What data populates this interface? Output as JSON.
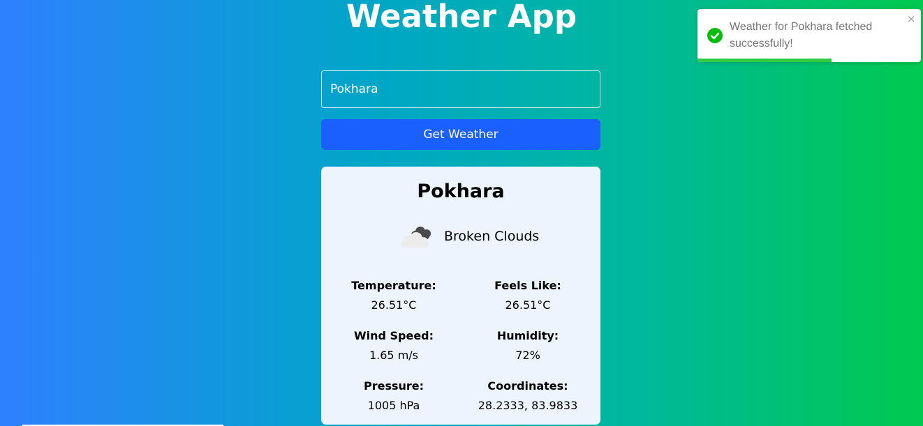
{
  "app": {
    "title": "Weather App"
  },
  "search": {
    "value": "Pokhara",
    "button_label": "Get Weather"
  },
  "weather": {
    "city": "Pokhara",
    "condition": "Broken Clouds",
    "icon": "broken-clouds-icon",
    "stats": [
      {
        "label": "Temperature:",
        "value": "26.51°C"
      },
      {
        "label": "Feels Like:",
        "value": "26.51°C"
      },
      {
        "label": "Wind Speed:",
        "value": "1.65 m/s"
      },
      {
        "label": "Humidity:",
        "value": "72%"
      },
      {
        "label": "Pressure:",
        "value": "1005 hPa"
      },
      {
        "label": "Coordinates:",
        "value": "28.2333, 83.9833"
      }
    ]
  },
  "toast": {
    "message": "Weather for Pokhara fetched successfully!",
    "close_glyph": "×",
    "icon": "check-circle-icon",
    "progress": 0.6,
    "accent_color": "#2ecc40"
  },
  "colors": {
    "button": "#1a5fff",
    "card": "#eef4fd",
    "gradient_start": "#2f80ff",
    "gradient_end": "#00c94f"
  }
}
